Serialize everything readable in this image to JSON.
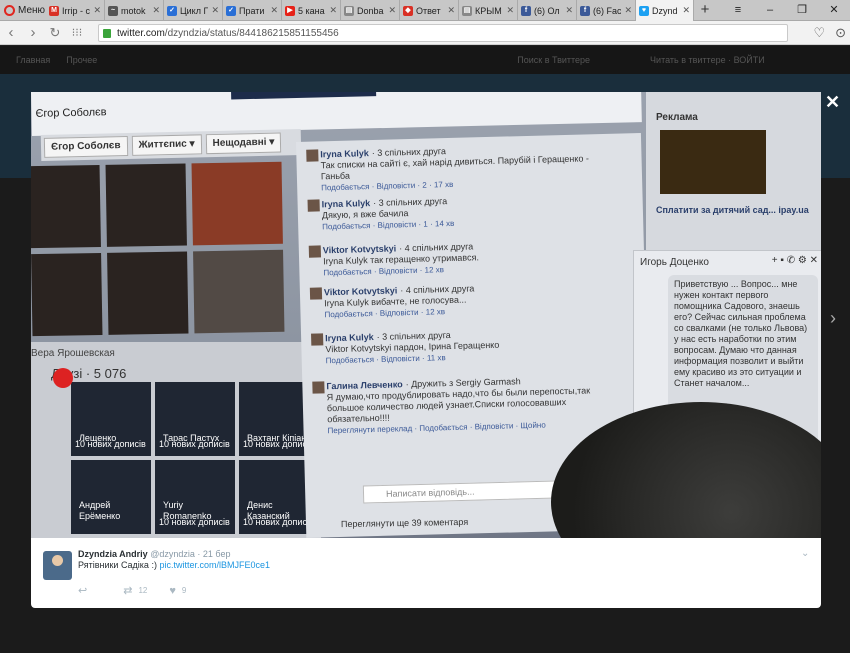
{
  "browser": {
    "menu_label": "Меню",
    "tabs": [
      {
        "title": "Irrip - c",
        "favicon": "gmail-icon",
        "color": "#d93025",
        "glyph": "M"
      },
      {
        "title": "motok",
        "favicon": "car-icon",
        "color": "#555555",
        "glyph": "~"
      },
      {
        "title": "Цикл Г",
        "favicon": "lun-icon",
        "color": "#2a6fd6",
        "glyph": "✓"
      },
      {
        "title": "Прати",
        "favicon": "lun-icon",
        "color": "#2a6fd6",
        "glyph": "✓"
      },
      {
        "title": "5 кана",
        "favicon": "youtube-icon",
        "color": "#e62117",
        "glyph": "▶"
      },
      {
        "title": "Donba",
        "favicon": "page-icon",
        "color": "#888888",
        "glyph": "▤"
      },
      {
        "title": "Ответ",
        "favicon": "site-icon",
        "color": "#d93025",
        "glyph": "◆"
      },
      {
        "title": "КРЫМ",
        "favicon": "page-icon",
        "color": "#888888",
        "glyph": "▤"
      },
      {
        "title": "(6) Ол",
        "favicon": "facebook-icon",
        "color": "#3b5998",
        "glyph": "f"
      },
      {
        "title": "(6) Fac",
        "favicon": "facebook-icon",
        "color": "#3b5998",
        "glyph": "f"
      },
      {
        "title": "Dzynd",
        "favicon": "twitter-icon",
        "color": "#1da1f2",
        "glyph": "♥",
        "active": true
      }
    ],
    "address": {
      "host": "twitter.com",
      "path": "/dzyndzia/status/844186215851155456"
    }
  },
  "twitter_bg": {
    "nav_items": [
      "Главная",
      "Прочее",
      "Поиск в Твиттере",
      "Читать в твиттере · ВОЙТИ"
    ]
  },
  "photo": {
    "profile_name": "Єгор Соболєв",
    "profile_tabs": [
      "Єгор Соболєв",
      "Життєпис ▾",
      "Нещодавні ▾"
    ],
    "friends_header": "Друзі · 5 076",
    "friend_top_text": "Вера Ярошевская",
    "friends": [
      {
        "name": "Лещенко",
        "sub": "10 нових дописів"
      },
      {
        "name": "Тарас Пастух",
        "sub": "10 нових дописів"
      },
      {
        "name": "Вахтанг Кіпіані",
        "sub": "10 нових дописів"
      },
      {
        "name": "Андрей Ерёменко",
        "sub": ""
      },
      {
        "name": "Yuriy Romanenko",
        "sub": "10 нових дописів"
      },
      {
        "name": "Денис Казанский",
        "sub": "10 нових дописів"
      }
    ],
    "comments": [
      {
        "author": "Iryna Kulyk",
        "mutual": "· 3 спільних друга",
        "text": "Так списки на сайті є, хай нарід дивиться. Парубій і Геращенко - Ганьба",
        "meta": "Подобається · Відповісти · 2 · 17 хв"
      },
      {
        "author": "Iryna Kulyk",
        "mutual": "· 3 спільних друга",
        "text": "Дякую, я вже бачила",
        "meta": "Подобається · Відповісти · 1 · 14 хв"
      },
      {
        "author": "Viktor Kotvytskyi",
        "mutual": "· 4 спільних друга",
        "text": "Iryna Kulyk так геращенко утримався.",
        "meta": "Подобається · Відповісти · 12 хв"
      },
      {
        "author": "Viktor Kotvytskyi",
        "mutual": "· 4 спільних друга",
        "text": "Iryna Kulyk вибачте, не голосува...",
        "meta": "Подобається · Відповісти · 12 хв"
      },
      {
        "author": "Iryna Kulyk",
        "mutual": "· 3 спільних друга",
        "text": "Viktor Kotvytskyi пардон, Ірина Геращенко",
        "meta": "Подобається · Відповісти · 11 хв"
      },
      {
        "author": "Галина Левченко",
        "mutual": "· Дружить з Sergiy Garmash",
        "text": "Я думаю,что продублировать надо,что бы были перепосты,так большое количество людей узнает.Списки голосовавших обязательно!!!!",
        "meta": "Переглянути переклад · Подобається · Відповісти · Щойно"
      }
    ],
    "reply_placeholder": "Написати відповідь...",
    "more_comments": "Переглянути ще 39 коментаря",
    "ads_header": "Реклама",
    "ad_text": "Сплатити за дитячий сад... ipay.ua",
    "chat_name": "Игорь Доценко",
    "chat_message": "Приветствую ... Вопрос... мне нужен контакт первого помощника Садового, знаешь его? Сейчас сильная проблема со свалками (не только Львова) у нас есть наработки по этим вопросам. Думаю что данная информация позволит и выйти ему красиво из это ситуации и Станет началом..."
  },
  "tweet": {
    "author_name": "Dzyndzia Andriy",
    "handle": "@dzyndzia",
    "date": "· 21 бер",
    "text": "Рятівники Садіка :)",
    "link": "pic.twitter.com/lBMJFE0ce1",
    "retweet_count": "12",
    "like_count": "9"
  }
}
